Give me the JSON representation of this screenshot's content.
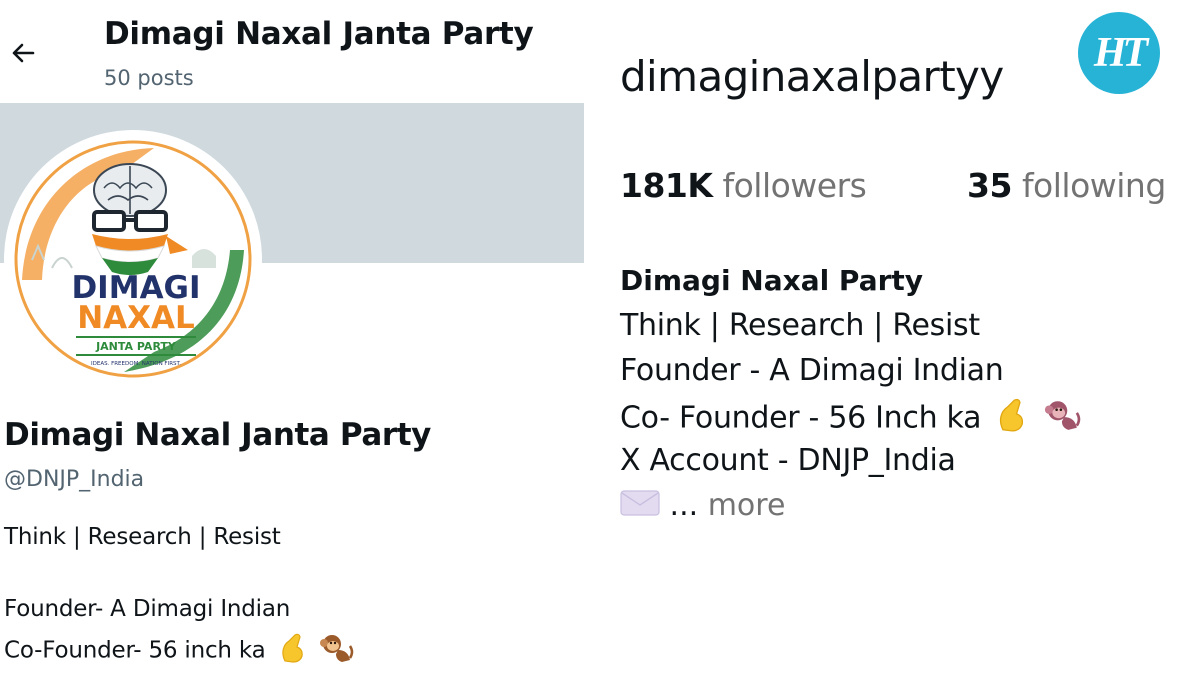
{
  "x_profile": {
    "header_title": "Dimagi Naxal Janta Party",
    "posts_count": "50 posts",
    "avatar_logo": {
      "line1": "DIMAGI",
      "line2": "NAXAL",
      "line3": "JANTA PARTY",
      "tagline": "IDEAS. FREEDOM. NATION FIRST."
    },
    "display_name": "Dimagi Naxal Janta Party",
    "handle": "@DNJP_India",
    "bio_lines": [
      "Think | Research | Resist",
      "Founder- A Dimagi Indian",
      "Co-Founder- 56 inch ka"
    ],
    "icons": [
      "back-arrow-icon",
      "pinched-fingers-emoji",
      "monkey-emoji"
    ],
    "colors": {
      "secondary_text": "#536471",
      "banner": "#cfd9de"
    }
  },
  "instagram_profile": {
    "username": "dimaginaxalpartyy",
    "followers_count": "181K",
    "followers_label": "followers",
    "following_count": "35",
    "following_label": "following",
    "bio_name": "Dimagi Naxal Party",
    "bio_lines": [
      "Think | Research | Resist",
      "Founder - A Dimagi Indian",
      "Co- Founder - 56 Inch ka",
      "X Account - DNJP_India"
    ],
    "ellipsis": "...",
    "more_label": "more",
    "icons": [
      "pinched-fingers-emoji",
      "monkey-emoji",
      "envelope-emoji"
    ],
    "colors": {
      "secondary_text": "#737373"
    }
  },
  "watermark": {
    "text": "HT",
    "color": "#27b3d6"
  }
}
